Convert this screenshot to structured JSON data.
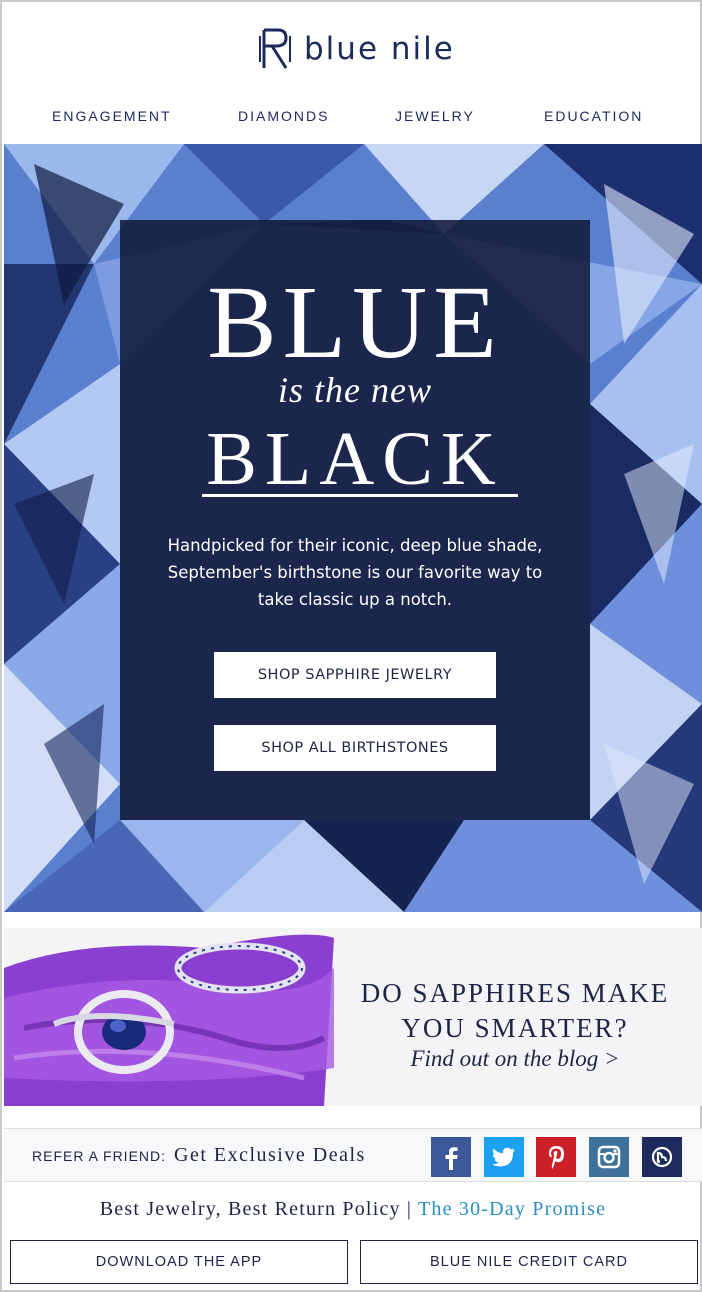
{
  "brand": {
    "name": "blue nile",
    "mark": "logo-monogram-icon"
  },
  "nav": {
    "items": [
      {
        "label": "ENGAGEMENT"
      },
      {
        "label": "DIAMONDS"
      },
      {
        "label": "JEWELRY"
      },
      {
        "label": "EDUCATION"
      }
    ]
  },
  "hero": {
    "line1": "BLUE",
    "line2": "is the new",
    "line3": "BLACK",
    "body": "Handpicked for their iconic, deep blue shade, September's birthstone is our favorite way to take classic up a notch.",
    "button1": "SHOP SAPPHIRE JEWELRY",
    "button2": "SHOP ALL BIRTHSTONES"
  },
  "blog": {
    "heading1": "DO SAPPHIRES MAKE",
    "heading2": "YOU SMARTER?",
    "link": "Find out on the blog >"
  },
  "refer": {
    "label": "REFER A FRIEND:",
    "deal": "Get Exclusive Deals",
    "social": [
      {
        "name": "facebook-icon",
        "color": "#3b5998"
      },
      {
        "name": "twitter-icon",
        "color": "#1da1f2"
      },
      {
        "name": "pinterest-icon",
        "color": "#cb2027"
      },
      {
        "name": "instagram-icon",
        "color": "#3f729b"
      },
      {
        "name": "blog-icon",
        "color": "#1c2a5c"
      }
    ]
  },
  "promise": {
    "text": "Best Jewelry, Best Return Policy |",
    "link": "The 30-Day Promise"
  },
  "footer": {
    "button1": "DOWNLOAD THE APP",
    "button2": "BLUE NILE CREDIT CARD"
  },
  "colors": {
    "navy": "#1c2545",
    "link": "#2a8fc1",
    "hero_blue": "#4a6fc0"
  }
}
